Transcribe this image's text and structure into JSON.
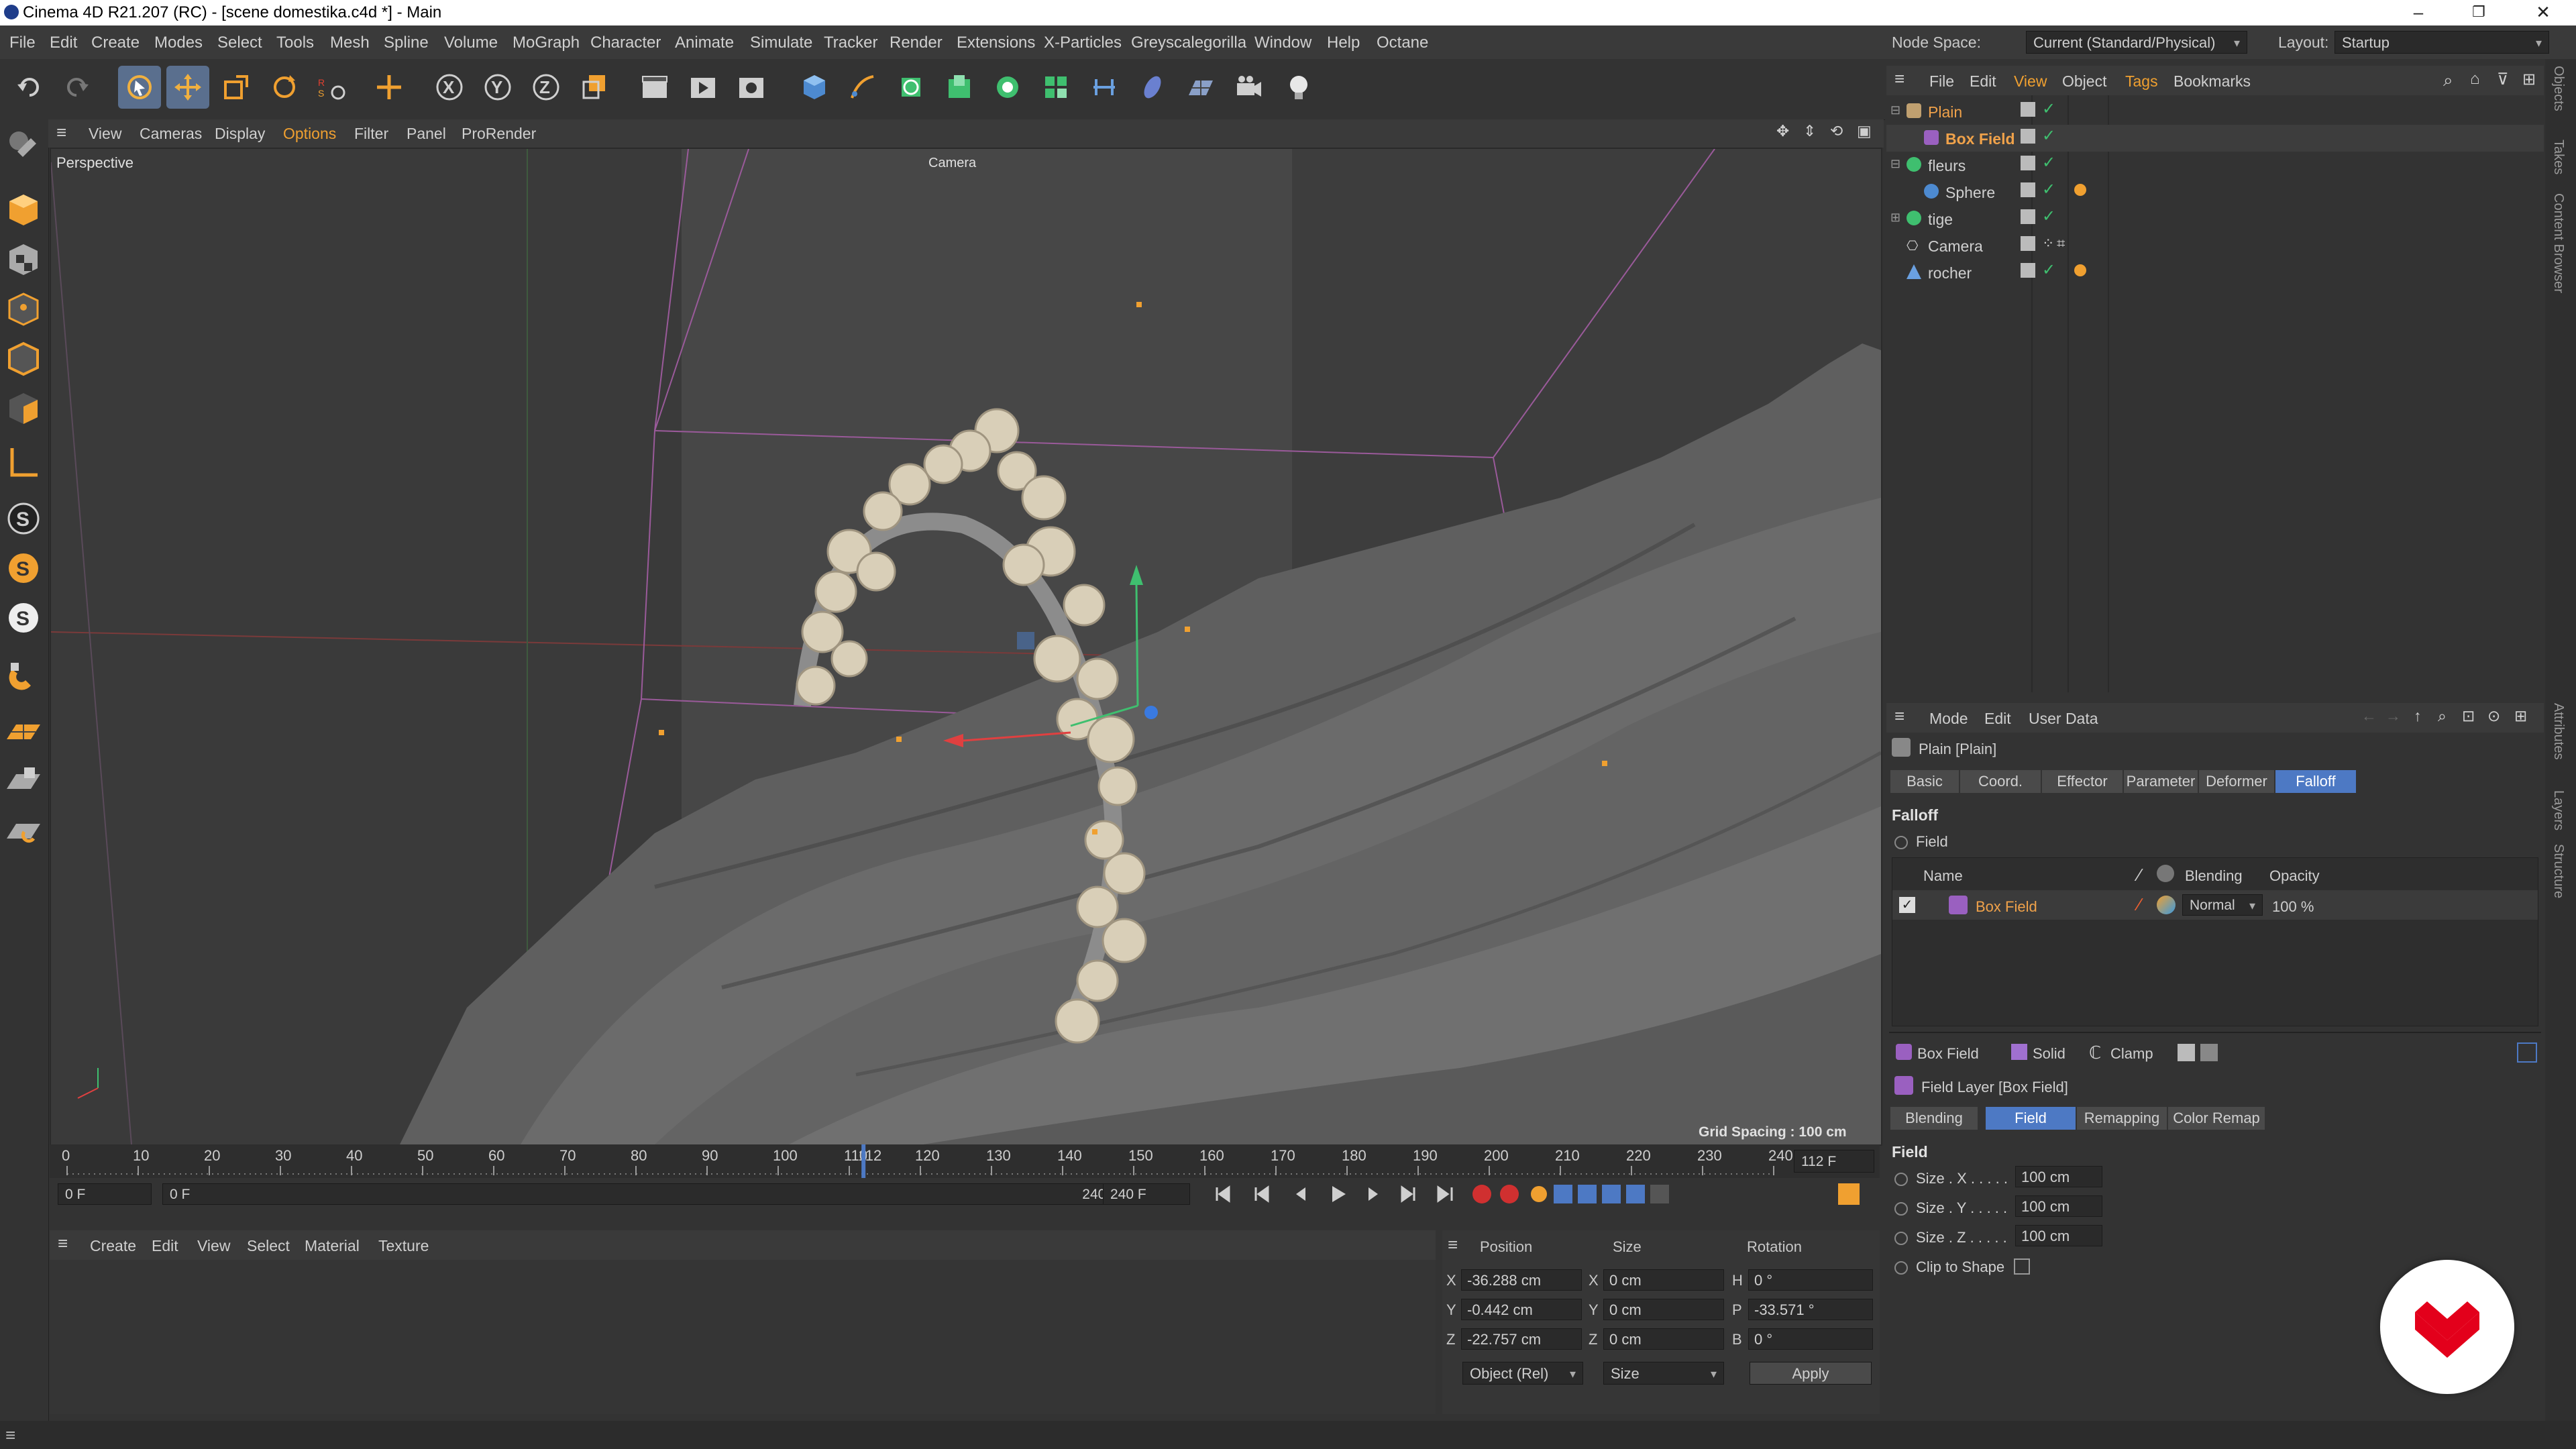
{
  "window": {
    "title": "Cinema 4D R21.207 (RC) - [scene domestika.c4d *] - Main",
    "min": "–",
    "max": "❐",
    "close": "✕"
  },
  "menubar": [
    "File",
    "Edit",
    "Create",
    "Modes",
    "Select",
    "Tools",
    "Mesh",
    "Spline",
    "Volume",
    "MoGraph",
    "Character",
    "Animate",
    "Simulate",
    "Tracker",
    "Render",
    "Extensions",
    "X-Particles",
    "Greyscalegorilla",
    "Window",
    "Help",
    "Octane"
  ],
  "nodespace": {
    "label": "Node Space:",
    "value": "Current (Standard/Physical)",
    "layout_label": "Layout:",
    "layout_value": "Startup"
  },
  "viewport_menu": [
    "View",
    "Cameras",
    "Display",
    "Options",
    "Filter",
    "Panel",
    "ProRender"
  ],
  "viewport": {
    "name": "Perspective",
    "camera_label": "Camera",
    "grid_spacing": "Grid Spacing : 100 cm"
  },
  "timeline": {
    "ticks": [
      "0",
      "10",
      "20",
      "30",
      "40",
      "50",
      "60",
      "70",
      "80",
      "90",
      "100",
      "110",
      "112",
      "120",
      "130",
      "140",
      "150",
      "160",
      "170",
      "180",
      "190",
      "200",
      "210",
      "220",
      "230",
      "240"
    ],
    "current": "112 F",
    "start": "0 F",
    "range_start": "0 F",
    "range_end": "240 F",
    "end": "240 F",
    "playhead_frame": 112,
    "max_frame": 240
  },
  "material_menu": [
    "Create",
    "Edit",
    "View",
    "Select",
    "Material",
    "Texture"
  ],
  "coords": {
    "headers": {
      "position": "Position",
      "size": "Size",
      "rotation": "Rotation"
    },
    "x": {
      "pos": "-36.288 cm",
      "size": "0 cm",
      "rot_label": "H",
      "rot": "0 °"
    },
    "y": {
      "pos": "-0.442 cm",
      "size": "0 cm",
      "rot_label": "P",
      "rot": "-33.571 °"
    },
    "z": {
      "pos": "-22.757 cm",
      "size": "0 cm",
      "rot_label": "B",
      "rot": "0 °"
    },
    "mode": "Object (Rel)",
    "size_mode": "Size",
    "apply": "Apply",
    "axis_x": "X",
    "axis_y": "Y",
    "axis_z": "Z"
  },
  "object_menu": [
    "File",
    "Edit",
    "View",
    "Object",
    "Tags",
    "Bookmarks"
  ],
  "objects": [
    {
      "name": "Plain",
      "color": "#f0a24a",
      "indent": 0
    },
    {
      "name": "Box Field",
      "color": "#f0a24a",
      "indent": 1
    },
    {
      "name": "fleurs",
      "color": "#cfcfcf",
      "indent": 0
    },
    {
      "name": "Sphere",
      "color": "#cfcfcf",
      "indent": 1
    },
    {
      "name": "tige",
      "color": "#cfcfcf",
      "indent": 0
    },
    {
      "name": "Camera",
      "color": "#cfcfcf",
      "indent": 0
    },
    {
      "name": "rocher",
      "color": "#cfcfcf",
      "indent": 0
    }
  ],
  "attr_menu": [
    "Mode",
    "Edit",
    "User Data"
  ],
  "attr": {
    "object_title": "Plain [Plain]",
    "tabs": [
      "Basic",
      "Coord.",
      "Effector",
      "Parameter",
      "Deformer",
      "Falloff"
    ],
    "active_tab": "Falloff",
    "section": "Falloff",
    "field_label": "Field",
    "columns": {
      "name": "Name",
      "blending": "Blending",
      "opacity": "Opacity"
    },
    "field_row": {
      "name": "Box Field",
      "blending": "Normal",
      "opacity": "100 %"
    },
    "layer_buttons": [
      "Box Field",
      "Solid",
      "Clamp"
    ],
    "layer_title": "Field Layer [Box Field]",
    "layer_tabs": [
      "Blending",
      "Field",
      "Remapping",
      "Color Remap"
    ],
    "layer_active_tab": "Field",
    "field_section": "Field",
    "size_x_label": "Size . X . . . . .",
    "size_x": "100 cm",
    "size_y_label": "Size . Y . . . . .",
    "size_y": "100 cm",
    "size_z_label": "Size . Z . . . . .",
    "size_z": "100 cm",
    "clip_label": "Clip to Shape"
  },
  "side_tabs": [
    "Objects",
    "Takes",
    "Content Browser",
    "Attributes",
    "Layers",
    "Structure"
  ],
  "colors": {
    "accent": "#4d79c4",
    "selected": "#f0a24a",
    "brand": "#e3001b"
  }
}
